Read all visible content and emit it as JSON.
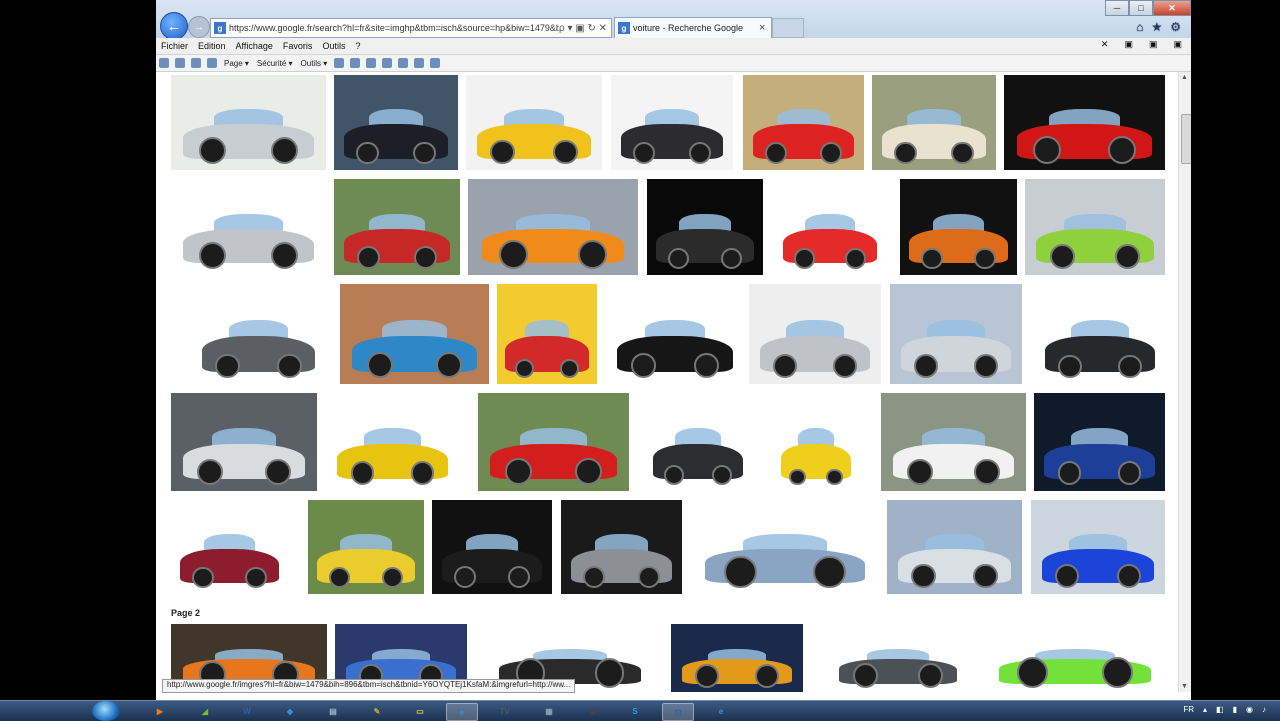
{
  "browser": {
    "url": "https://www.google.fr/search?hl=fr&site=imghp&tbm=isch&source=hp&biw=1479&b",
    "address_controls": "ρ ▾ ▣ ↻ ✕",
    "tabs": [
      {
        "label": "voiture - Recherche Google",
        "favicon": "g-favicon"
      }
    ],
    "menu": [
      "Fichier",
      "Edition",
      "Affichage",
      "Favoris",
      "Outils",
      "?"
    ],
    "commands": [
      "Page ▾",
      "Sécurité ▾",
      "Outils ▾"
    ],
    "toolbar_right_icons": [
      "home-icon",
      "star-icon",
      "gear-icon"
    ],
    "window_controls": [
      "─",
      "□",
      "✕"
    ]
  },
  "results": {
    "page2_label": "Page 2",
    "rows": [
      [
        {
          "bg": "#e9ece7",
          "car": "#c8cdd2",
          "kind": "concept"
        },
        {
          "bg": "#405568",
          "car": "#1e1e28",
          "kind": "sport"
        },
        {
          "bg": "#f2f2f2",
          "car": "#f1c21b",
          "kind": "cartoon"
        },
        {
          "bg": "#f4f4f4",
          "car": "#2c2c30",
          "kind": "sedan"
        },
        {
          "bg": "#c4ae7c",
          "car": "#dd2222",
          "kind": "sport"
        },
        {
          "bg": "#9aa07f",
          "car": "#e8e2cf",
          "kind": "old"
        },
        {
          "bg": "#111111",
          "car": "#d21616",
          "kind": "sport"
        }
      ],
      [
        {
          "bg": "#ffffff",
          "car": "#c1c4c8",
          "kind": "hatch"
        },
        {
          "bg": "#6e8b56",
          "car": "#c62828",
          "kind": "truck"
        },
        {
          "bg": "#9aa3ad",
          "car": "#f08a1a",
          "kind": "sport"
        },
        {
          "bg": "#090909",
          "car": "#2b2b2b",
          "kind": "sport"
        },
        {
          "bg": "#ffffff",
          "car": "#e52a2a",
          "kind": "cartoon"
        },
        {
          "bg": "#111111",
          "car": "#dd6b1a",
          "kind": "sport"
        },
        {
          "bg": "#c8cdd3",
          "car": "#8fd13d",
          "kind": "sport"
        }
      ],
      [
        {
          "bg": "#ffffff",
          "car": "#5b5f63",
          "kind": "hatch"
        },
        {
          "bg": "#b97d55",
          "car": "#2e88c8",
          "kind": "hatch"
        },
        {
          "bg": "#f2cb2f",
          "car": "#d22a2a",
          "kind": "cartoon"
        },
        {
          "bg": "#ffffff",
          "car": "#161616",
          "kind": "sport"
        },
        {
          "bg": "#eeeeee",
          "car": "#bfc3c7",
          "kind": "sedan"
        },
        {
          "bg": "#b8c5d4",
          "car": "#cfd5db",
          "kind": "sport"
        },
        {
          "bg": "#ffffff",
          "car": "#26282b",
          "kind": "hatch"
        }
      ],
      [
        {
          "bg": "#5a6066",
          "car": "#d9dcdf",
          "kind": "concept"
        },
        {
          "bg": "#ffffff",
          "car": "#e6c410",
          "kind": "muscle"
        },
        {
          "bg": "#6f8a52",
          "car": "#d41d1d",
          "kind": "sport"
        },
        {
          "bg": "#ffffff",
          "car": "#2b2d30",
          "kind": "suv"
        },
        {
          "bg": "#ffffff",
          "car": "#f0cf1c",
          "kind": "toy"
        },
        {
          "bg": "#8a9583",
          "car": "#f1f1f1",
          "kind": "hatch"
        },
        {
          "bg": "#0f1a2a",
          "car": "#1d3f9a",
          "kind": "rally"
        }
      ],
      [
        {
          "bg": "#ffffff",
          "car": "#8c1c2e",
          "kind": "mpv"
        },
        {
          "bg": "#6c8a4a",
          "car": "#eacd2c",
          "kind": "truck"
        },
        {
          "bg": "#111111",
          "car": "#1c1c1c",
          "kind": "sport"
        },
        {
          "bg": "#1a1a1a",
          "car": "#8c9096",
          "kind": "muscle"
        },
        {
          "bg": "#ffffff",
          "car": "#8aa4c4",
          "kind": "hatch"
        },
        {
          "bg": "#9fb2c8",
          "car": "#dadfe5",
          "kind": "concept"
        },
        {
          "bg": "#cdd6de",
          "car": "#1b45d8",
          "kind": "hatch"
        }
      ],
      [
        {
          "bg": "#40362a",
          "car": "#e8761c",
          "kind": "sport"
        },
        {
          "bg": "#2b3a6c",
          "car": "#3b6fcf",
          "kind": "tuned"
        },
        {
          "bg": "#ffffff",
          "car": "#2a2a2a",
          "kind": "concept"
        },
        {
          "bg": "#1b2a4a",
          "car": "#e39a1a",
          "kind": "tuned"
        },
        {
          "bg": "#ffffff",
          "car": "#4c5157",
          "kind": "hatch"
        },
        {
          "bg": "#ffffff",
          "car": "#74e03a",
          "kind": "cartoon"
        }
      ]
    ]
  },
  "status": {
    "hover_url": "http://www.google.fr/imgres?hl=fr&biw=1479&bih=896&tbm=isch&tbnid=Y6OYQTEj1KsfaM:&imgrefurl=http://ww..."
  },
  "taskbar": {
    "apps": [
      {
        "name": "media-player-icon",
        "label": "▶",
        "color": "#e87d1e"
      },
      {
        "name": "app-icon",
        "label": "◢",
        "color": "#6fbf3a"
      },
      {
        "name": "word-icon",
        "label": "W",
        "color": "#2b5fb4"
      },
      {
        "name": "app2-icon",
        "label": "◆",
        "color": "#3c8fd6"
      },
      {
        "name": "doc-icon",
        "label": "▤",
        "color": "#9eb5d0"
      },
      {
        "name": "paint-icon",
        "label": "✎",
        "color": "#d0a23a"
      },
      {
        "name": "folder-icon",
        "label": "▭",
        "color": "#e5c54a"
      },
      {
        "name": "ie-icon",
        "label": "e",
        "color": "#3a8fe0"
      },
      {
        "name": "tv-icon",
        "label": "TV",
        "color": "#555555"
      },
      {
        "name": "files-icon",
        "label": "▦",
        "color": "#8e9fb3"
      },
      {
        "name": "dvd-icon",
        "label": "◉",
        "color": "#444444"
      },
      {
        "name": "skype-icon",
        "label": "S",
        "color": "#1ea2e0"
      },
      {
        "name": "capture-icon",
        "label": "⊡",
        "color": "#2c60a8"
      },
      {
        "name": "ie2-icon",
        "label": "e",
        "color": "#3a8fe0"
      }
    ],
    "lang": "FR",
    "tray": [
      "▴",
      "◧",
      "▮",
      "◉",
      "♪"
    ]
  }
}
